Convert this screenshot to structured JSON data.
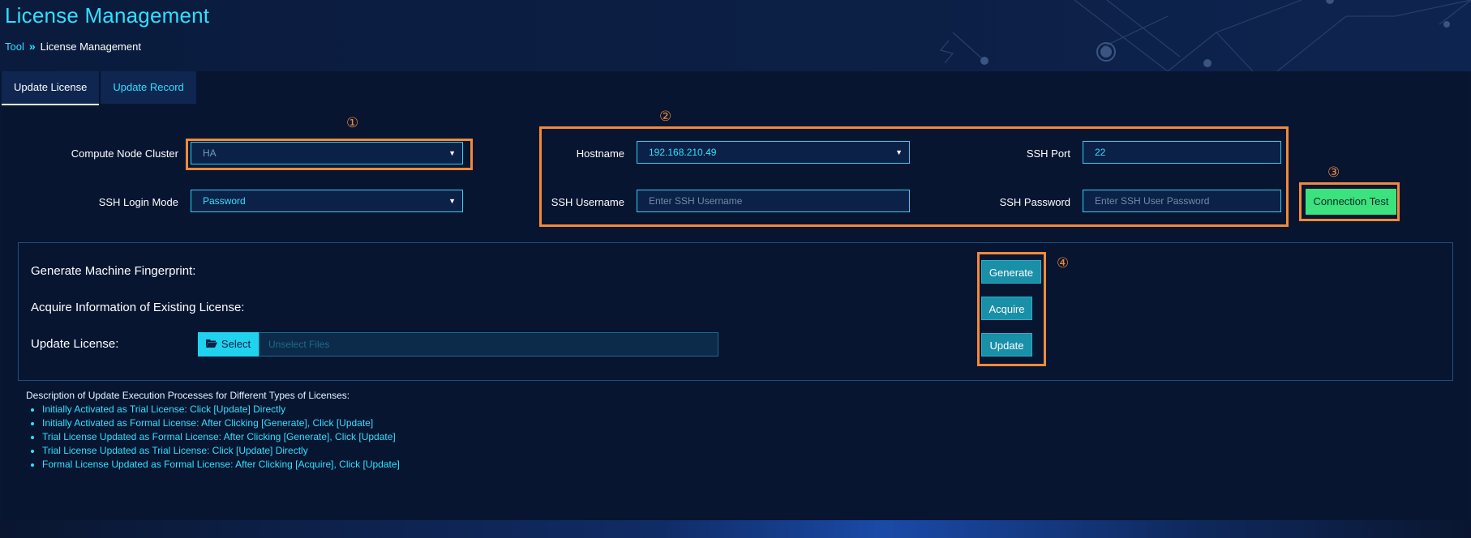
{
  "page": {
    "title": "License Management"
  },
  "breadcrumb": {
    "root": "Tool",
    "current": "License Management"
  },
  "tabs": [
    {
      "label": "Update License",
      "active": true
    },
    {
      "label": "Update Record",
      "active": false
    }
  ],
  "form": {
    "cluster": {
      "label": "Compute Node Cluster",
      "value": "HA"
    },
    "login_mode": {
      "label": "SSH Login Mode",
      "value": "Password"
    },
    "hostname": {
      "label": "Hostname",
      "value": "192.168.210.49"
    },
    "ssh_port": {
      "label": "SSH Port",
      "value": "22"
    },
    "ssh_username": {
      "label": "SSH Username",
      "placeholder": "Enter SSH Username"
    },
    "ssh_password": {
      "label": "SSH Password",
      "placeholder": "Enter SSH User Password"
    },
    "connection_test_label": "Connection Test"
  },
  "markers": [
    "①",
    "②",
    "③",
    "④"
  ],
  "actions": {
    "generate": {
      "label": "Generate Machine Fingerprint:",
      "button": "Generate"
    },
    "acquire": {
      "label": "Acquire Information of Existing License:",
      "button": "Acquire"
    },
    "update": {
      "label": "Update License:",
      "button": "Update",
      "select_label": "Select",
      "file_placeholder": "Unselect Files"
    }
  },
  "description": {
    "title": "Description of Update Execution Processes for Different Types of Licenses:",
    "items": [
      "Initially Activated as Trial License: Click [Update] Directly",
      "Initially Activated as Formal License: After Clicking [Generate], Click [Update]",
      "Trial License Updated as Formal License: After Clicking [Generate], Click [Update]",
      "Trial License Updated as Trial License: Click [Update] Directly",
      "Formal License Updated as Formal License: After Clicking [Acquire], Click [Update]"
    ]
  },
  "colors": {
    "accent": "#2fe0ff",
    "highlight": "#f28a3b",
    "success": "#3be27d",
    "button": "#1a8fa8"
  },
  "icons": {
    "select": "folder-open-icon",
    "dropdown": "caret-down-icon"
  }
}
